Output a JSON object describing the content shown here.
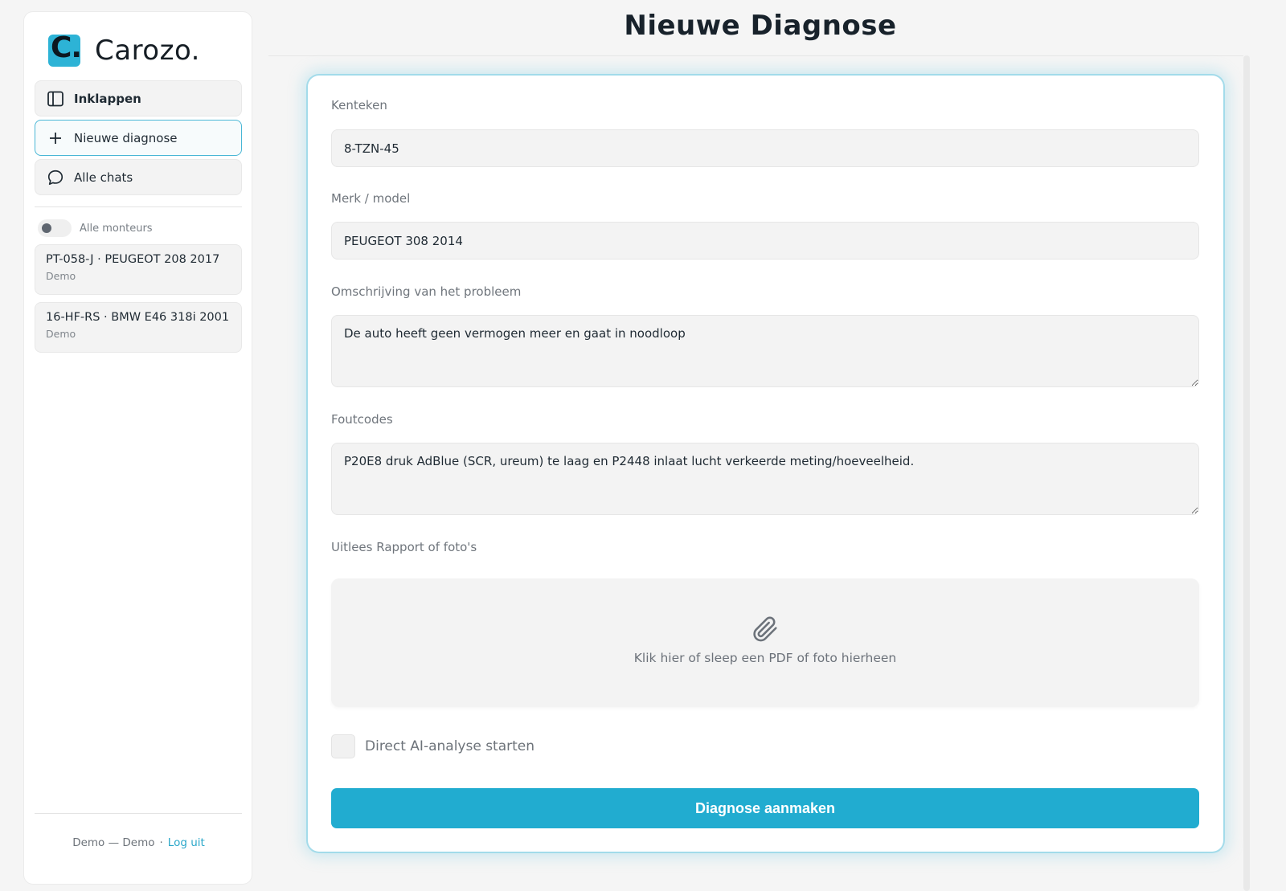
{
  "brand": {
    "name": "Carozo.",
    "mark": "C."
  },
  "sidebar": {
    "collapse_label": "Inklappen",
    "new_diagnosis_label": "Nieuwe diagnose",
    "all_chats_label": "Alle chats",
    "all_mechanics_label": "Alle monteurs",
    "all_mechanics_on": false,
    "chats": [
      {
        "title": "PT-058-J · PEUGEOT 208 2017",
        "subtitle": "Demo"
      },
      {
        "title": "16-HF-RS · BMW E46 318i 2001",
        "subtitle": "Demo"
      }
    ],
    "footer": {
      "user": "Demo — Demo",
      "separator": "·",
      "logout": "Log uit"
    }
  },
  "page": {
    "title": "Nieuwe Diagnose"
  },
  "form": {
    "license_plate": {
      "label": "Kenteken",
      "value": "8-TZN-45"
    },
    "make_model": {
      "label": "Merk / model",
      "value": "PEUGEOT 308 2014"
    },
    "problem": {
      "label": "Omschrijving van het probleem",
      "value": "De auto heeft geen vermogen meer en gaat in noodloop"
    },
    "fault_codes": {
      "label": "Foutcodes",
      "value": "P20E8 druk AdBlue (SCR, ureum) te laag en P2448 inlaat lucht verkeerde meting/hoeveelheid."
    },
    "upload": {
      "label": "Uitlees Rapport of foto's",
      "hint": "Klik hier of sleep een PDF of foto hierheen",
      "icon": "paperclip-icon"
    },
    "auto_analysis": {
      "label": "Direct AI-analyse starten",
      "checked": false
    },
    "submit_label": "Diagnose aanmaken"
  },
  "colors": {
    "accent": "#21acd0",
    "logo": "#2db3d6",
    "active_border": "#4ab7d6"
  }
}
